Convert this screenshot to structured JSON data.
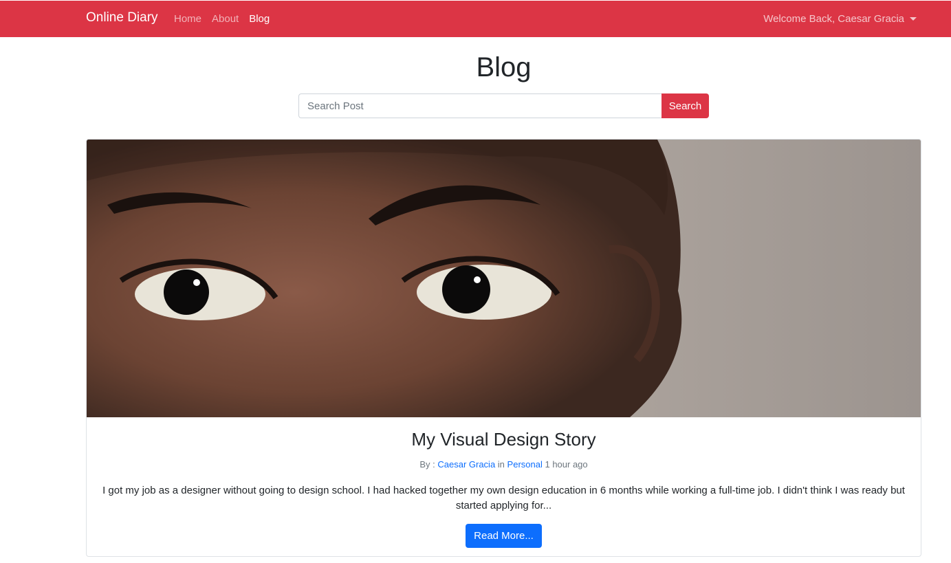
{
  "navbar": {
    "brand": "Online Diary",
    "links": [
      {
        "label": "Home",
        "active": false
      },
      {
        "label": "About",
        "active": false
      },
      {
        "label": "Blog",
        "active": true
      }
    ],
    "user_menu": "Welcome Back, Caesar Gracia"
  },
  "page": {
    "title": "Blog"
  },
  "search": {
    "placeholder": "Search Post",
    "button": "Search"
  },
  "post": {
    "title": "My Visual Design Story",
    "by_label": "By :",
    "author": "Caesar Gracia",
    "in_label": "in",
    "category": "Personal",
    "time": "1 hour ago",
    "excerpt": "I got my job as a designer without going to design school. I had hacked together my own design education in 6 months while working a full-time job. I didn't think I was ready but started applying for...",
    "read_more": "Read More..."
  },
  "colors": {
    "navbar": "#dc3545",
    "search_button": "#dc3545",
    "primary": "#0d6efd"
  }
}
